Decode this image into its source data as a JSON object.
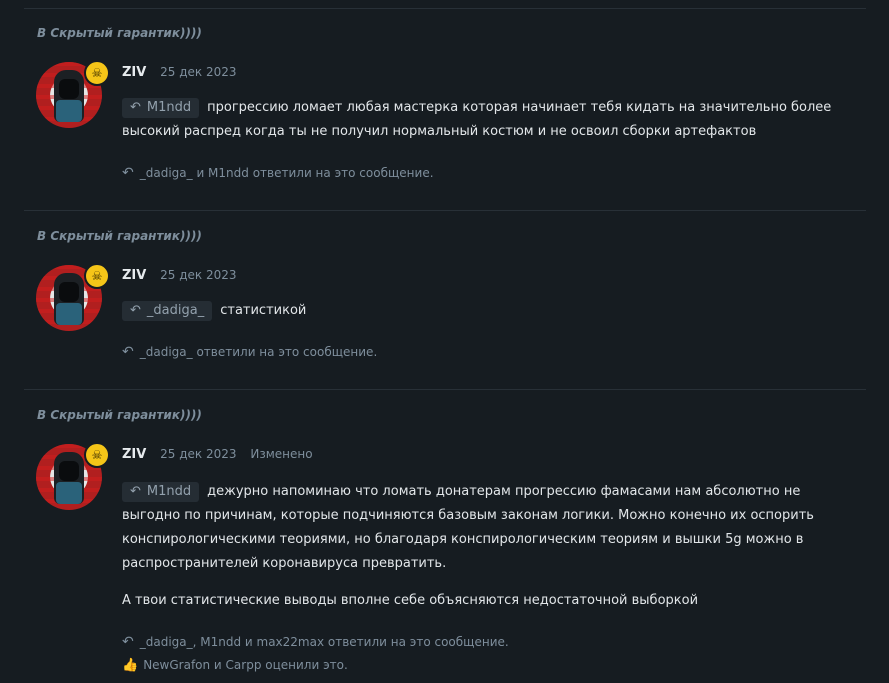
{
  "posts": [
    {
      "header_prefix": "В",
      "header_thread": "Скрытый гарантик))))",
      "author": "ZIV",
      "date": "25 дек 2023",
      "edited": "",
      "quote_user": "M1ndd",
      "text": "прогрессию ломает любая мастерка которая начинает тебя кидать на значительно более высокий распред когда ты не получил нормальный костюм и не освоил сборки артефактов",
      "text2": "",
      "replies": "_dadiga_ и M1ndd ответили на это сообщение.",
      "likes": ""
    },
    {
      "header_prefix": "В",
      "header_thread": "Скрытый гарантик))))",
      "author": "ZIV",
      "date": "25 дек 2023",
      "edited": "",
      "quote_user": "_dadiga_",
      "text": "статистикой",
      "text2": "",
      "replies": "_dadiga_ ответили на это сообщение.",
      "likes": ""
    },
    {
      "header_prefix": "В",
      "header_thread": "Скрытый гарантик))))",
      "author": "ZIV",
      "date": "25 дек 2023",
      "edited": "Изменено",
      "quote_user": "M1ndd",
      "text": "дежурно напоминаю что ломать донатерам прогрессию фамасами нам абсолютно не выгодно по причинам, которые подчиняются базовым законам логики. Можно конечно их оспорить конспирологическими теориями, но благодаря конспирологическим теориям и вышки 5g можно в распространителей коронавируса превратить.",
      "text2": "А твои статистические выводы вполне себе объясняются недостаточной выборкой",
      "replies": "_dadiga_, M1ndd и max22max ответили на это сообщение.",
      "likes": "NewGrafon и Carpp оценили это."
    }
  ],
  "colors": {
    "background": "#161c21",
    "muted": "#7e8e9c",
    "text": "#e2e6e9",
    "badge": "#f5c518"
  },
  "icons": {
    "reply": "reply-arrow-icon",
    "like": "thumbs-up-icon",
    "badge": "skull-badge-icon"
  }
}
